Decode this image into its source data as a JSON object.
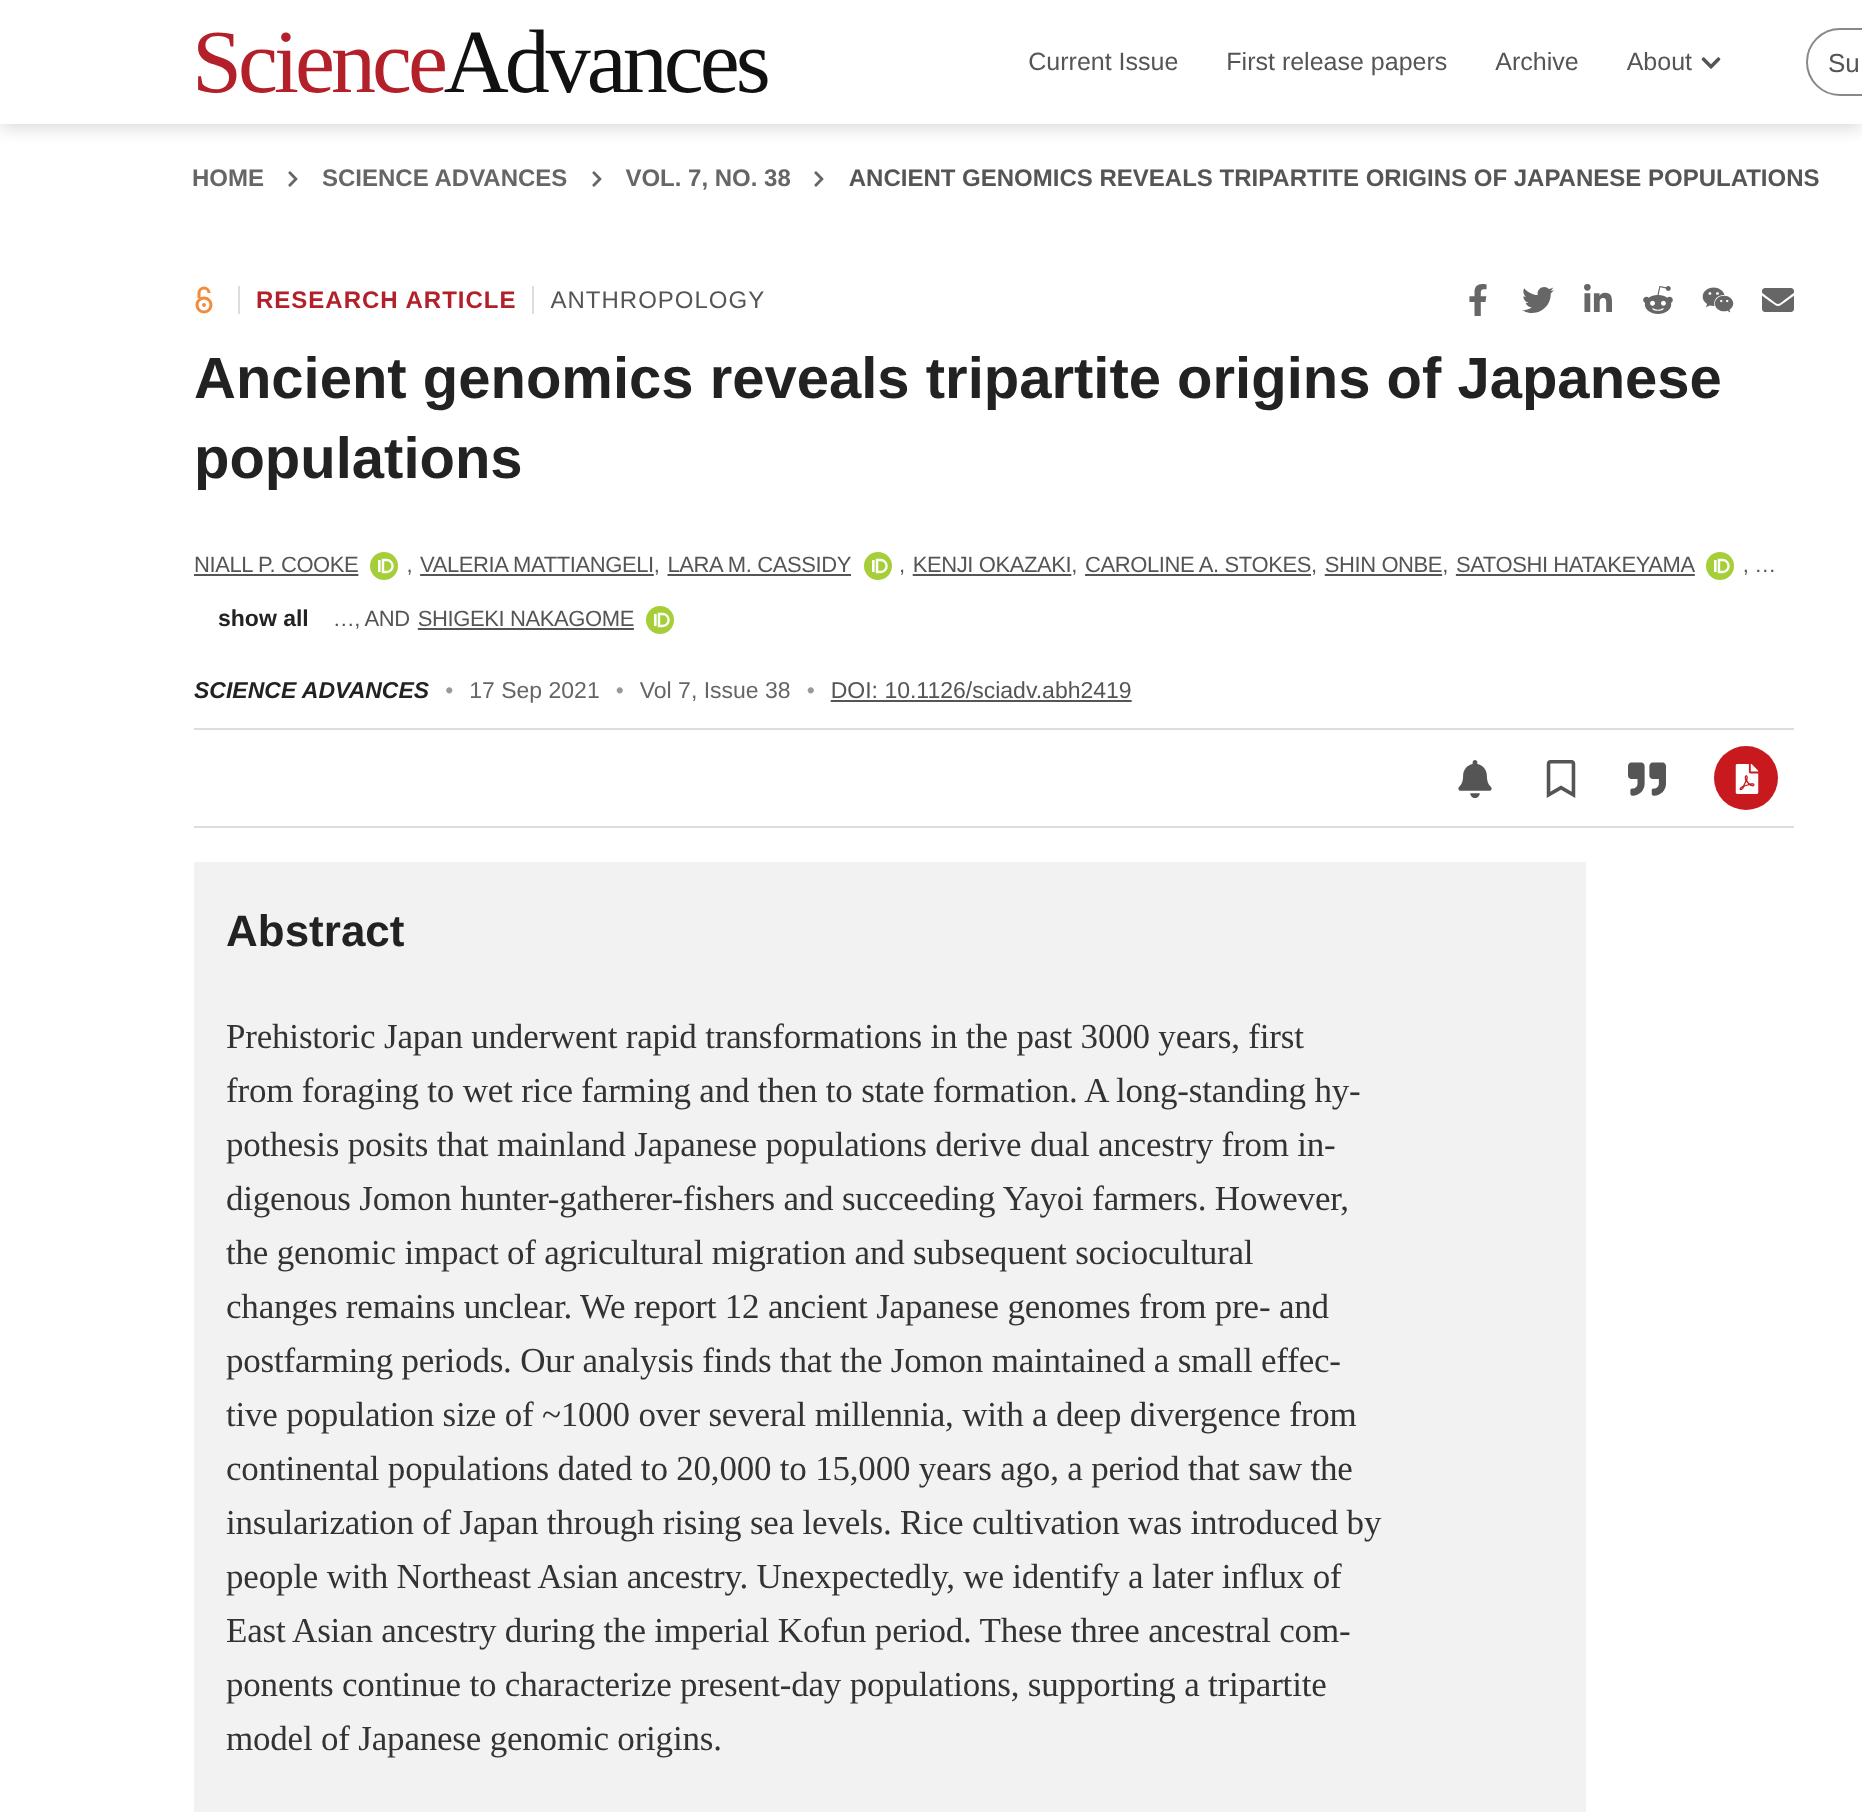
{
  "header": {
    "logo": {
      "first": "Science",
      "second": "Advances"
    },
    "nav": [
      {
        "label": "Current Issue",
        "dropdown": false
      },
      {
        "label": "First release papers",
        "dropdown": false
      },
      {
        "label": "Archive",
        "dropdown": false
      },
      {
        "label": "About",
        "dropdown": true
      }
    ],
    "cut_button": "Su"
  },
  "breadcrumb": [
    "HOME",
    "SCIENCE ADVANCES",
    "VOL. 7, NO. 38",
    "ANCIENT GENOMICS REVEALS TRIPARTITE ORIGINS OF JAPANESE POPULATIONS"
  ],
  "article": {
    "open_access": true,
    "type": "RESEARCH ARTICLE",
    "subject": "ANTHROPOLOGY",
    "share": [
      {
        "kind": "facebook"
      },
      {
        "kind": "twitter"
      },
      {
        "kind": "linkedin"
      },
      {
        "kind": "reddit"
      },
      {
        "kind": "wechat"
      },
      {
        "kind": "email"
      }
    ],
    "title": "Ancient genomics reveals tripartite origins of Japanese populations",
    "authors": [
      {
        "kind": "author",
        "text": "NIALL P. COOKE",
        "orcid": true
      },
      {
        "kind": "text",
        "text": ","
      },
      {
        "kind": "author",
        "text": "VALERIA MATTIANGELI",
        "orcid": false
      },
      {
        "kind": "text",
        "text": ","
      },
      {
        "kind": "author",
        "text": "LARA M. CASSIDY",
        "orcid": true
      },
      {
        "kind": "text",
        "text": ","
      },
      {
        "kind": "author",
        "text": "KENJI OKAZAKI",
        "orcid": false
      },
      {
        "kind": "text",
        "text": ","
      },
      {
        "kind": "author",
        "text": "CAROLINE A. STOKES",
        "orcid": false
      },
      {
        "kind": "text",
        "text": ","
      },
      {
        "kind": "author",
        "text": "SHIN ONBE",
        "orcid": false
      },
      {
        "kind": "text",
        "text": ","
      },
      {
        "kind": "author",
        "text": "SATOSHI HATAKEYAMA",
        "orcid": true
      },
      {
        "kind": "text",
        "text": ", …"
      },
      {
        "kind": "button",
        "text": "show all"
      },
      {
        "kind": "text",
        "text": "…, AND"
      },
      {
        "kind": "author",
        "text": "SHIGEKI NAKAGOME",
        "orcid": true
      }
    ],
    "publication": [
      {
        "kind": "journal",
        "text": "SCIENCE ADVANCES"
      },
      {
        "kind": "dot",
        "text": "•"
      },
      {
        "kind": "date",
        "text": "17 Sep 2021"
      },
      {
        "kind": "dot",
        "text": "•"
      },
      {
        "kind": "issue",
        "text": "Vol 7, Issue 38"
      },
      {
        "kind": "dot",
        "text": "•"
      },
      {
        "kind": "doi",
        "text": "DOI: 10.1126/sciadv.abh2419"
      }
    ],
    "actions": [
      {
        "kind": "alert"
      },
      {
        "kind": "bookmark"
      },
      {
        "kind": "cite"
      },
      {
        "kind": "pdf"
      }
    ]
  },
  "abstract": {
    "heading": "Abstract",
    "lines": [
      "Prehistoric Japan underwent rapid transformations in the past 3000 years, first",
      "from foraging to wet rice farming and then to state formation. A long-standing hy-",
      "pothesis posits that mainland Japanese populations derive dual ancestry from in-",
      "digenous Jomon hunter-gatherer-fishers and succeeding Yayoi farmers. However,",
      "the genomic impact of agricultural migration and subsequent sociocultural",
      "changes remains unclear. We report 12 ancient Japanese genomes from pre- and",
      "postfarming periods. Our analysis finds that the Jomon maintained a small effec-",
      "tive population size of ~1000 over several millennia, with a deep divergence from",
      "continental populations dated to 20,000 to 15,000 years ago, a period that saw the",
      "insularization of Japan through rising sea levels. Rice cultivation was introduced by",
      "people with Northeast Asian ancestry. Unexpectedly, we identify a later influx of",
      "East Asian ancestry during the imperial Kofun period. These three ancestral com-",
      "ponents continue to characterize present-day populations, supporting a tripartite",
      "model of Japanese genomic origins."
    ]
  }
}
